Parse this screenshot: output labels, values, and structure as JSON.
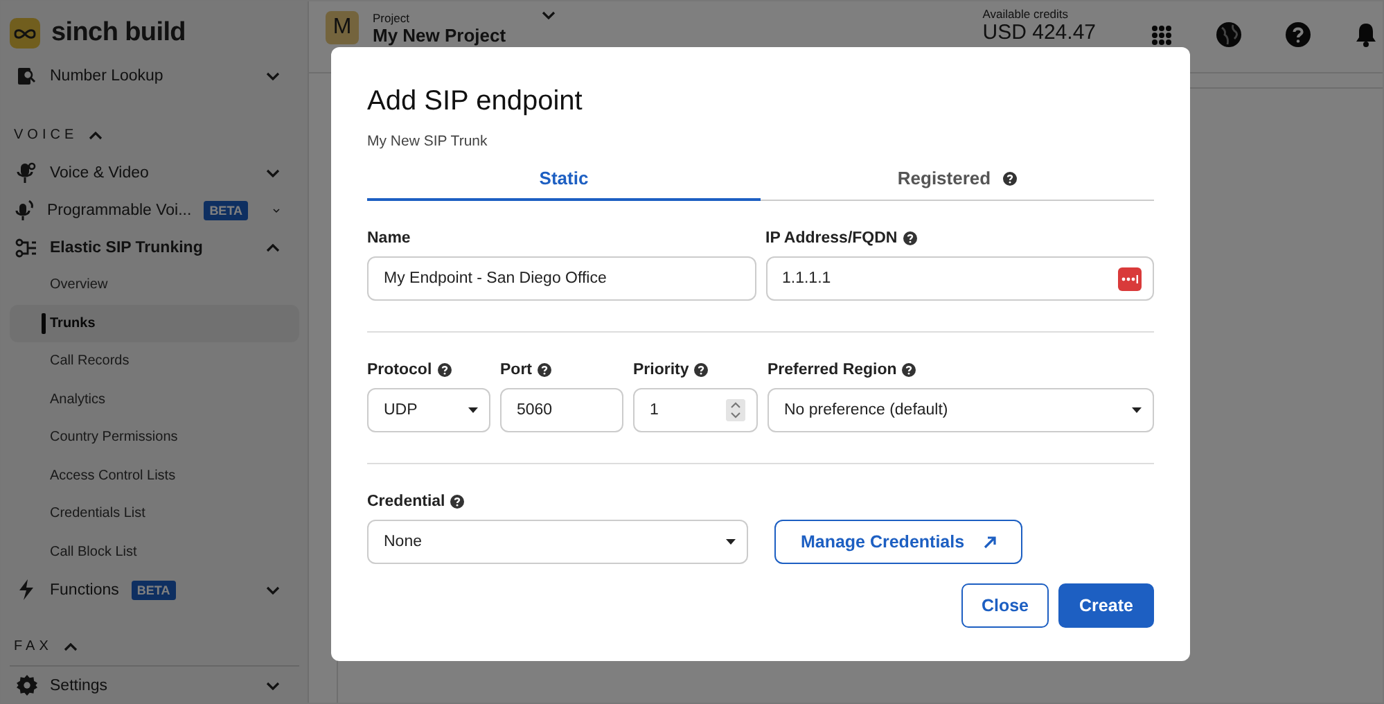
{
  "sidebar": {
    "logo": "sinch build",
    "items": [
      {
        "kind": "nav",
        "label": "Number Lookup",
        "expanded": false
      },
      {
        "kind": "section",
        "label": "VOICE",
        "expanded": true
      },
      {
        "kind": "nav",
        "label": "Voice & Video",
        "expanded": false
      },
      {
        "kind": "nav",
        "label": "Programmable Voi...",
        "badge": "BETA",
        "expanded": false
      },
      {
        "kind": "nav",
        "label": "Elastic SIP Trunking",
        "expanded": true
      },
      {
        "kind": "sub",
        "label": "Overview",
        "selected": false
      },
      {
        "kind": "sub",
        "label": "Trunks",
        "selected": true
      },
      {
        "kind": "sub",
        "label": "Call Records",
        "selected": false
      },
      {
        "kind": "sub",
        "label": "Analytics",
        "selected": false
      },
      {
        "kind": "sub",
        "label": "Country Permissions",
        "selected": false
      },
      {
        "kind": "sub",
        "label": "Access Control Lists",
        "selected": false
      },
      {
        "kind": "sub",
        "label": "Credentials List",
        "selected": false
      },
      {
        "kind": "sub",
        "label": "Call Block List",
        "selected": false
      },
      {
        "kind": "nav",
        "label": "Functions",
        "badge": "BETA",
        "expanded": false
      },
      {
        "kind": "section",
        "label": "FAX",
        "expanded": true
      },
      {
        "kind": "nav",
        "label": "Settings",
        "expanded": false
      }
    ]
  },
  "header": {
    "project": {
      "avatar": "M",
      "caption": "Project",
      "name": "My New Project"
    },
    "credits": {
      "caption": "Available credits",
      "amount": "USD 424.47"
    }
  },
  "dialog": {
    "title": "Add SIP endpoint",
    "subtitle": "My New SIP Trunk",
    "tabs": [
      {
        "label": "Static",
        "selected": true,
        "help": false
      },
      {
        "label": "Registered",
        "selected": false,
        "help": true
      }
    ],
    "rows": [
      [
        {
          "kind": "text",
          "label": "Name",
          "help": false,
          "value": "My Endpoint - San Diego Office"
        },
        {
          "kind": "secret",
          "label": "IP Address/FQDN",
          "help": true,
          "value": "1.1.1.1"
        }
      ],
      [
        {
          "kind": "select",
          "label": "Protocol",
          "help": true,
          "value": "UDP"
        },
        {
          "kind": "text",
          "label": "Port",
          "help": true,
          "value": "5060"
        },
        {
          "kind": "number",
          "label": "Priority",
          "help": true,
          "value": "1"
        },
        {
          "kind": "select",
          "label": "Preferred Region",
          "help": true,
          "value": "No preference (default)"
        }
      ],
      [
        {
          "kind": "select",
          "label": "Credential",
          "help": true,
          "value": "None"
        },
        {
          "kind": "link",
          "label": "Manage Credentials"
        }
      ]
    ],
    "buttons": [
      {
        "kind": "secondary",
        "label": "Close"
      },
      {
        "kind": "primary",
        "label": "Create"
      }
    ]
  }
}
